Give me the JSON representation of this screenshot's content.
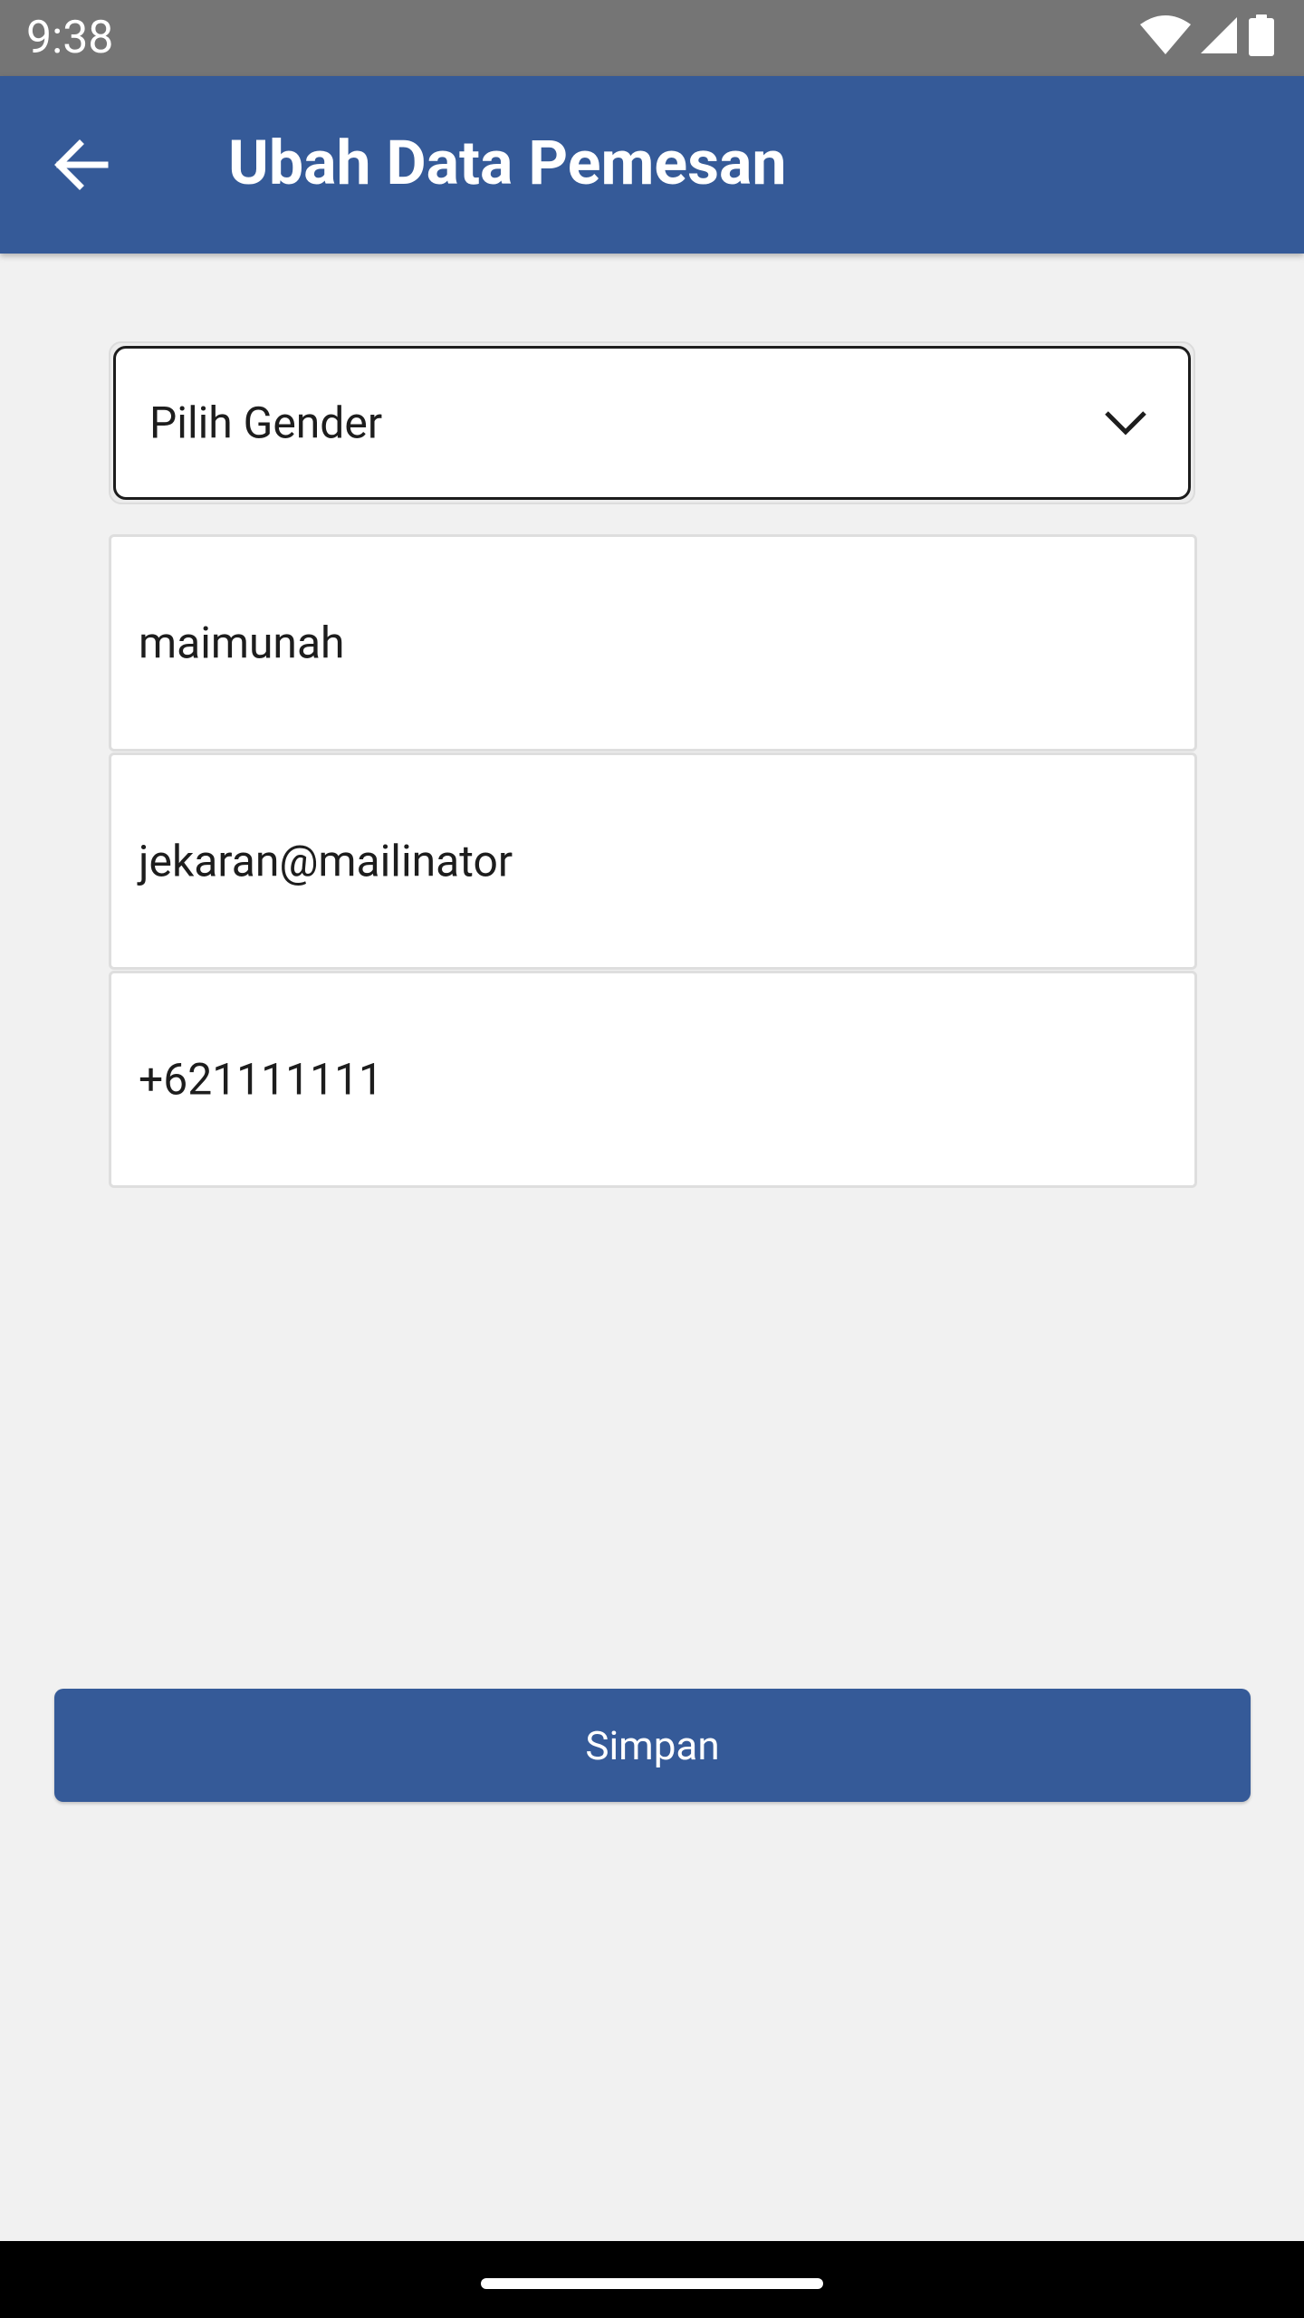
{
  "status_bar": {
    "time": "9:38",
    "icons": [
      "wifi-icon",
      "cellular-signal-icon",
      "battery-icon"
    ]
  },
  "app_bar": {
    "back_icon": "arrow-left-icon",
    "title": "Ubah Data Pemesan"
  },
  "form": {
    "gender": {
      "value": "Pilih Gender",
      "icon": "chevron-down-icon"
    },
    "name": {
      "value": "maimunah"
    },
    "email": {
      "value": "jekaran@mailinator"
    },
    "phone": {
      "value": "+621111111"
    }
  },
  "save_button": {
    "label": "Simpan"
  },
  "colors": {
    "primary": "#355a98",
    "background": "#f1f1f1",
    "status_bar": "#757575",
    "text": "#1d1d1d"
  }
}
